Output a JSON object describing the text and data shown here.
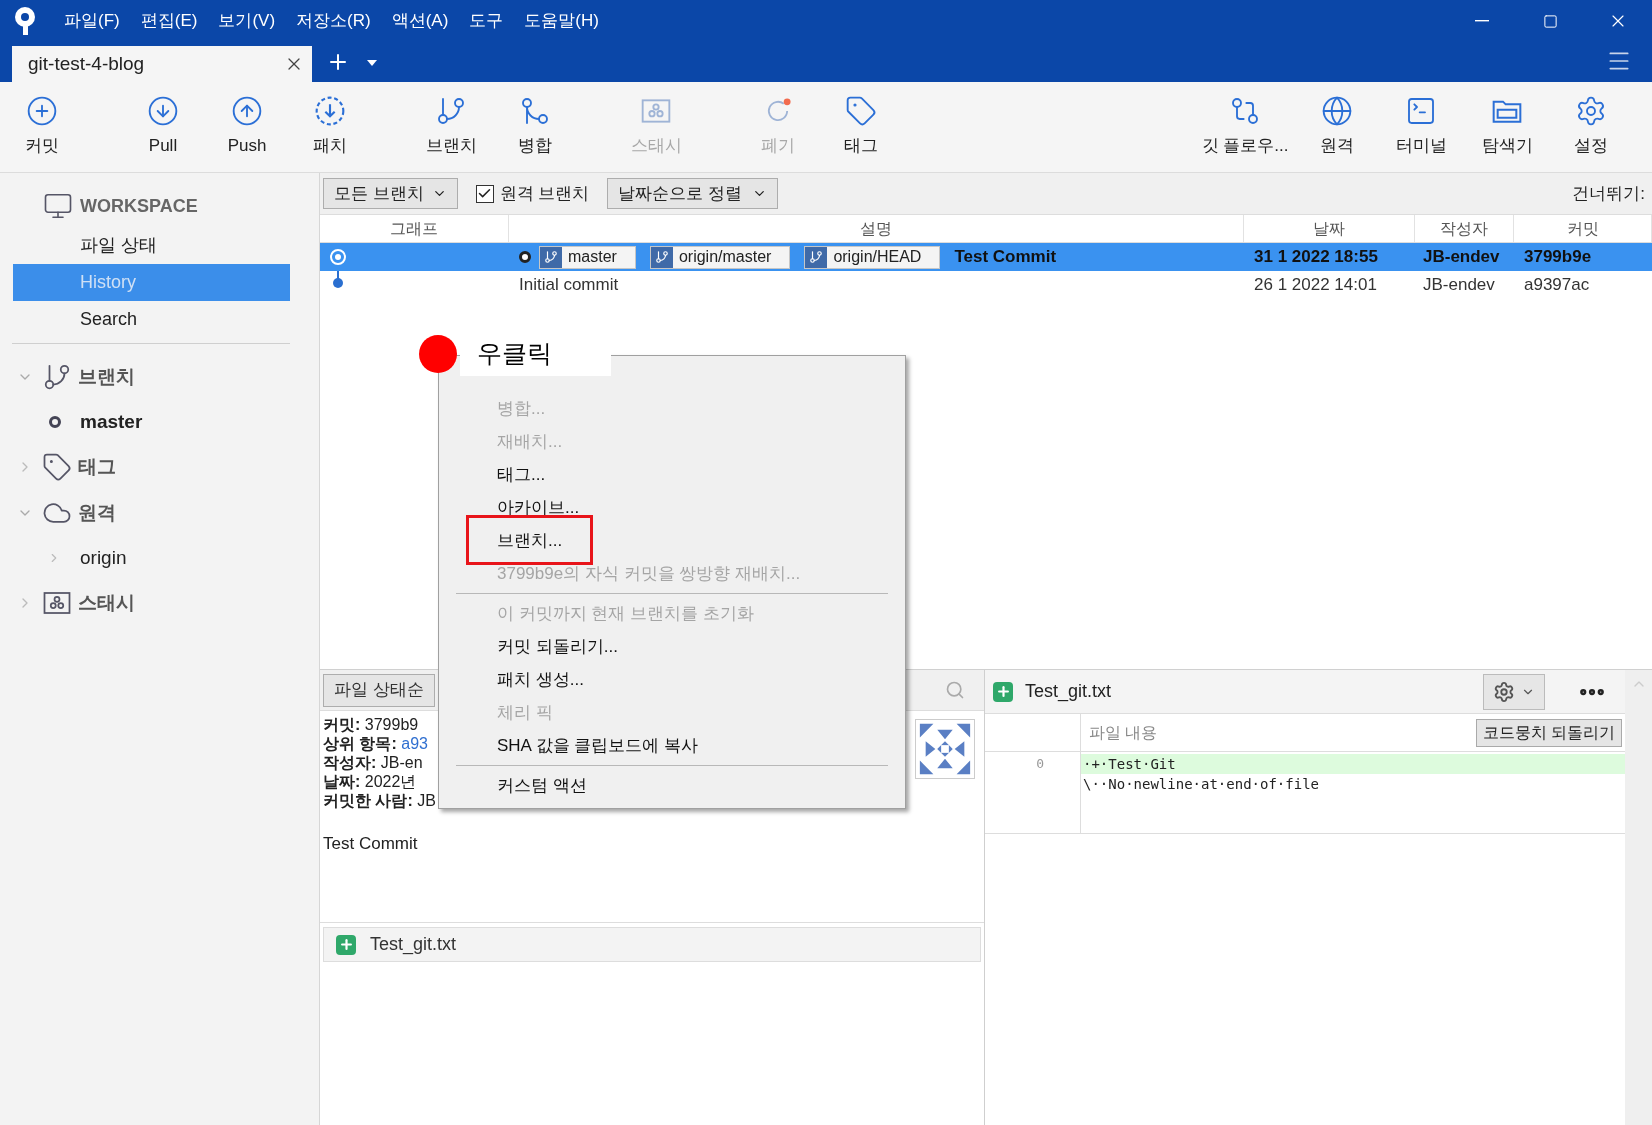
{
  "window": {
    "menus": [
      "파일(F)",
      "편집(E)",
      "보기(V)",
      "저장소(R)",
      "액션(A)",
      "도구",
      "도움말(H)"
    ]
  },
  "tabs": [
    {
      "label": "git-test-4-blog",
      "selected": true
    }
  ],
  "toolbar": {
    "left": [
      {
        "label": "커밋",
        "disabled": false
      },
      {
        "label": "Pull",
        "disabled": false
      },
      {
        "label": "Push",
        "disabled": false
      },
      {
        "label": "패치",
        "disabled": false
      },
      {
        "label": "브랜치",
        "disabled": false
      },
      {
        "label": "병합",
        "disabled": false
      },
      {
        "label": "스태시",
        "disabled": true
      },
      {
        "label": "폐기",
        "disabled": true
      },
      {
        "label": "태그",
        "disabled": false
      }
    ],
    "right": [
      {
        "label": "깃 플로우...",
        "disabled": false
      },
      {
        "label": "원격",
        "disabled": false
      },
      {
        "label": "터미널",
        "disabled": false
      },
      {
        "label": "탐색기",
        "disabled": false
      },
      {
        "label": "설정",
        "disabled": false
      }
    ]
  },
  "sidebar": {
    "workspace": {
      "title": "WORKSPACE",
      "items": [
        {
          "label": "파일 상태",
          "selected": false
        },
        {
          "label": "History",
          "selected": true
        },
        {
          "label": "Search",
          "selected": false
        }
      ]
    },
    "groups": [
      {
        "label": "브랜치",
        "expanded": true,
        "children": [
          {
            "label": "master",
            "current": true
          }
        ]
      },
      {
        "label": "태그",
        "expanded": false
      },
      {
        "label": "원격",
        "expanded": true,
        "children": [
          {
            "label": "origin",
            "expanded": false
          }
        ]
      },
      {
        "label": "스태시",
        "expanded": false
      }
    ]
  },
  "filter_bar": {
    "branch_dropdown": "모든 브랜치",
    "remote_checkbox": {
      "label": "원격 브랜치",
      "checked": true
    },
    "sort_dropdown": "날짜순으로 정렬",
    "jump_label": "건너뛰기:"
  },
  "commit_table": {
    "columns": [
      "그래프",
      "설명",
      "날짜",
      "작성자",
      "커밋"
    ],
    "rows": [
      {
        "selected": true,
        "refs": [
          {
            "label": "master",
            "current": true
          },
          {
            "label": "origin/master",
            "current": false
          },
          {
            "label": "origin/HEAD",
            "current": false
          }
        ],
        "description": "Test Commit",
        "date": "31 1 2022 18:55",
        "author": "JB-endev",
        "commit": "3799b9e"
      },
      {
        "selected": false,
        "refs": [],
        "description": "Initial commit",
        "date": "26 1 2022 14:01",
        "author": "JB-endev",
        "commit": "a9397ac"
      }
    ]
  },
  "details": {
    "sort_button": "파일 상태순",
    "lines": [
      {
        "key": "커밋:",
        "value": "3799b9",
        "link": false
      },
      {
        "key": "상위 항목:",
        "value": "a93",
        "link": true
      },
      {
        "key": "작성자:",
        "value": "JB-en",
        "link": false
      },
      {
        "key": "날짜:",
        "value": "2022년",
        "link": false
      },
      {
        "key": "커밋한 사람:",
        "value": "JB",
        "link": false
      }
    ],
    "message": "Test Commit",
    "files": [
      {
        "name": "Test_git.txt",
        "kind": "added"
      }
    ]
  },
  "diff": {
    "file": "Test_git.txt",
    "kind": "added",
    "column_header": "파일 내용",
    "revert_button": "코드뭉치 되돌리기",
    "lines": [
      {
        "kind": "added",
        "number": "0",
        "text": "·+·Test·Git"
      },
      {
        "kind": "meta",
        "text": "\\··No·newline·at·end·of·file"
      }
    ]
  },
  "context_menu": {
    "items": [
      {
        "kind": "item",
        "label": "병합...",
        "disabled": true,
        "highlighted": false
      },
      {
        "kind": "item",
        "label": "재배치...",
        "disabled": true,
        "highlighted": false
      },
      {
        "kind": "item",
        "label": "태그...",
        "disabled": false,
        "highlighted": false
      },
      {
        "kind": "item",
        "label": "아카이브...",
        "disabled": false,
        "highlighted": false
      },
      {
        "kind": "item",
        "label": "브랜치...",
        "disabled": false,
        "highlighted": true
      },
      {
        "kind": "item",
        "label": "3799b9e의 자식 커밋을 쌍방향 재배치...",
        "disabled": true,
        "highlighted": false
      },
      {
        "kind": "separator"
      },
      {
        "kind": "item",
        "label": "이 커밋까지 현재 브랜치를 초기화",
        "disabled": true,
        "highlighted": false
      },
      {
        "kind": "item",
        "label": "커밋 되돌리기...",
        "disabled": false,
        "highlighted": false
      },
      {
        "kind": "item",
        "label": "패치 생성...",
        "disabled": false,
        "highlighted": false
      },
      {
        "kind": "item",
        "label": "체리 픽",
        "disabled": true,
        "highlighted": false
      },
      {
        "kind": "item",
        "label": "SHA 값을 클립보드에 복사",
        "disabled": false,
        "highlighted": false
      },
      {
        "kind": "separator"
      },
      {
        "kind": "item",
        "label": "커스텀 액션",
        "disabled": false,
        "highlighted": false
      }
    ]
  },
  "annotation": {
    "label": "우클릭"
  }
}
